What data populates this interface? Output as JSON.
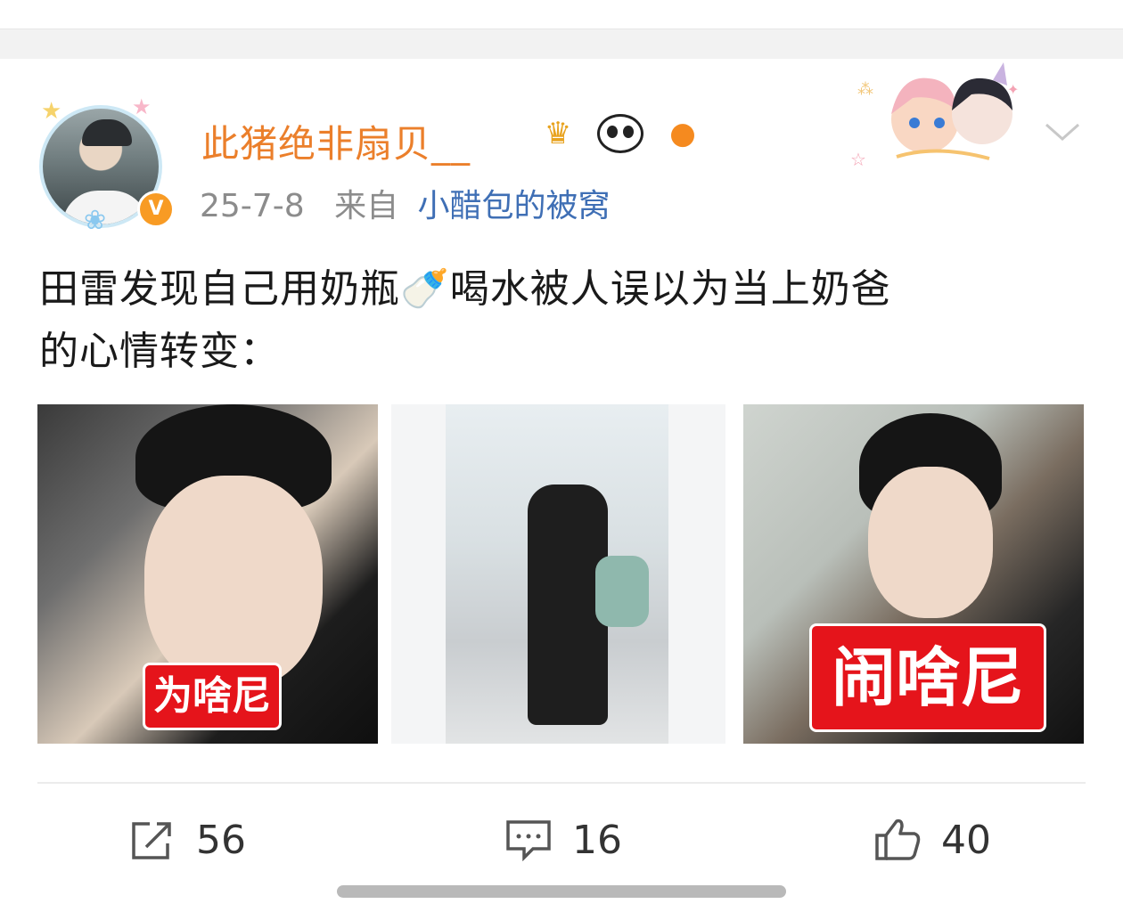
{
  "user": {
    "name": "此猪绝非扇贝__",
    "verified_badge": "V",
    "badge_icons": [
      "crown-badge-icon",
      "panda-badge-icon",
      "fish-badge-icon"
    ]
  },
  "post": {
    "date": "25-7-8",
    "from_label": "来自",
    "source": "小醋包的被窝",
    "text_line1": "田雷发现自己用奶瓶🍼喝水被人误以为当上奶爸",
    "text_line2": "的心情转变：",
    "images": [
      {
        "caption": "为啥尼"
      },
      {
        "caption": ""
      },
      {
        "caption": "闹啥尼"
      }
    ]
  },
  "actions": {
    "repost_count": "56",
    "comment_count": "16",
    "like_count": "40"
  },
  "colors": {
    "username": "#eb7f2b",
    "source_link": "#3f6fb5",
    "meta_gray": "#8c8c8c",
    "caption_red": "#e5141b",
    "verified_orange": "#f89b24"
  }
}
